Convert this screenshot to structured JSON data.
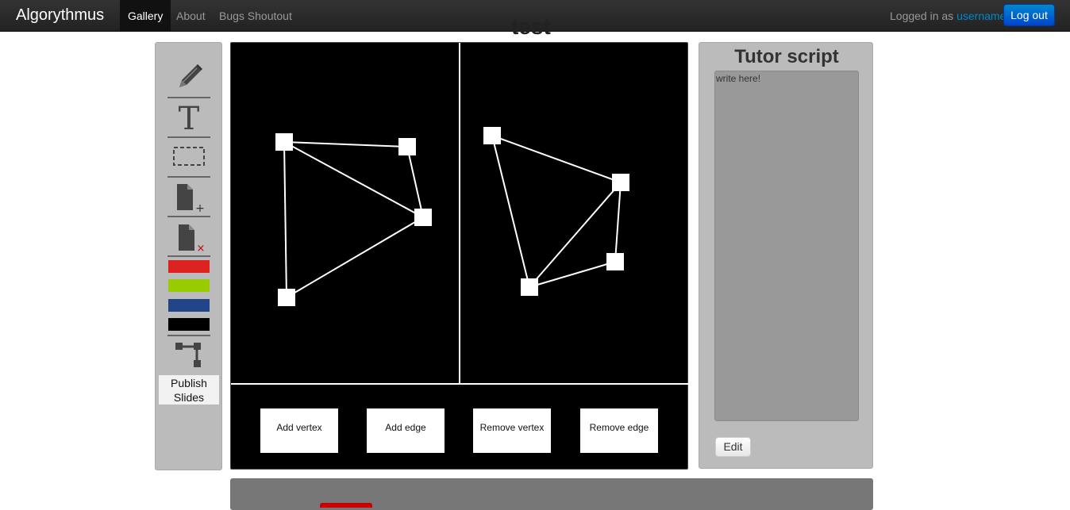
{
  "navbar": {
    "brand": "Algorythmus",
    "items": [
      {
        "label": "Gallery",
        "active": true
      },
      {
        "label": "About",
        "active": false
      },
      {
        "label": "Bugs Shoutout",
        "active": false
      }
    ],
    "logged_in_prefix": "Logged in as ",
    "username": "username",
    "logout_label": "Log out"
  },
  "slide": {
    "title": "test"
  },
  "toolbar": {
    "tools": [
      "pencil-icon",
      "text-tool-icon",
      "selection-rect-icon",
      "add-slide-icon",
      "delete-slide-icon"
    ],
    "colors": [
      "#dd2222",
      "#99cc00",
      "#224488",
      "#000000"
    ],
    "graph_tool": "graph-tool-icon",
    "publish_label": "Publish Slides"
  },
  "canvas": {
    "actions": [
      "Add vertex",
      "Add edge",
      "Remove vertex",
      "Remove edge"
    ]
  },
  "tutor": {
    "title": "Tutor script",
    "text": "write here!",
    "edit_label": "Edit"
  }
}
